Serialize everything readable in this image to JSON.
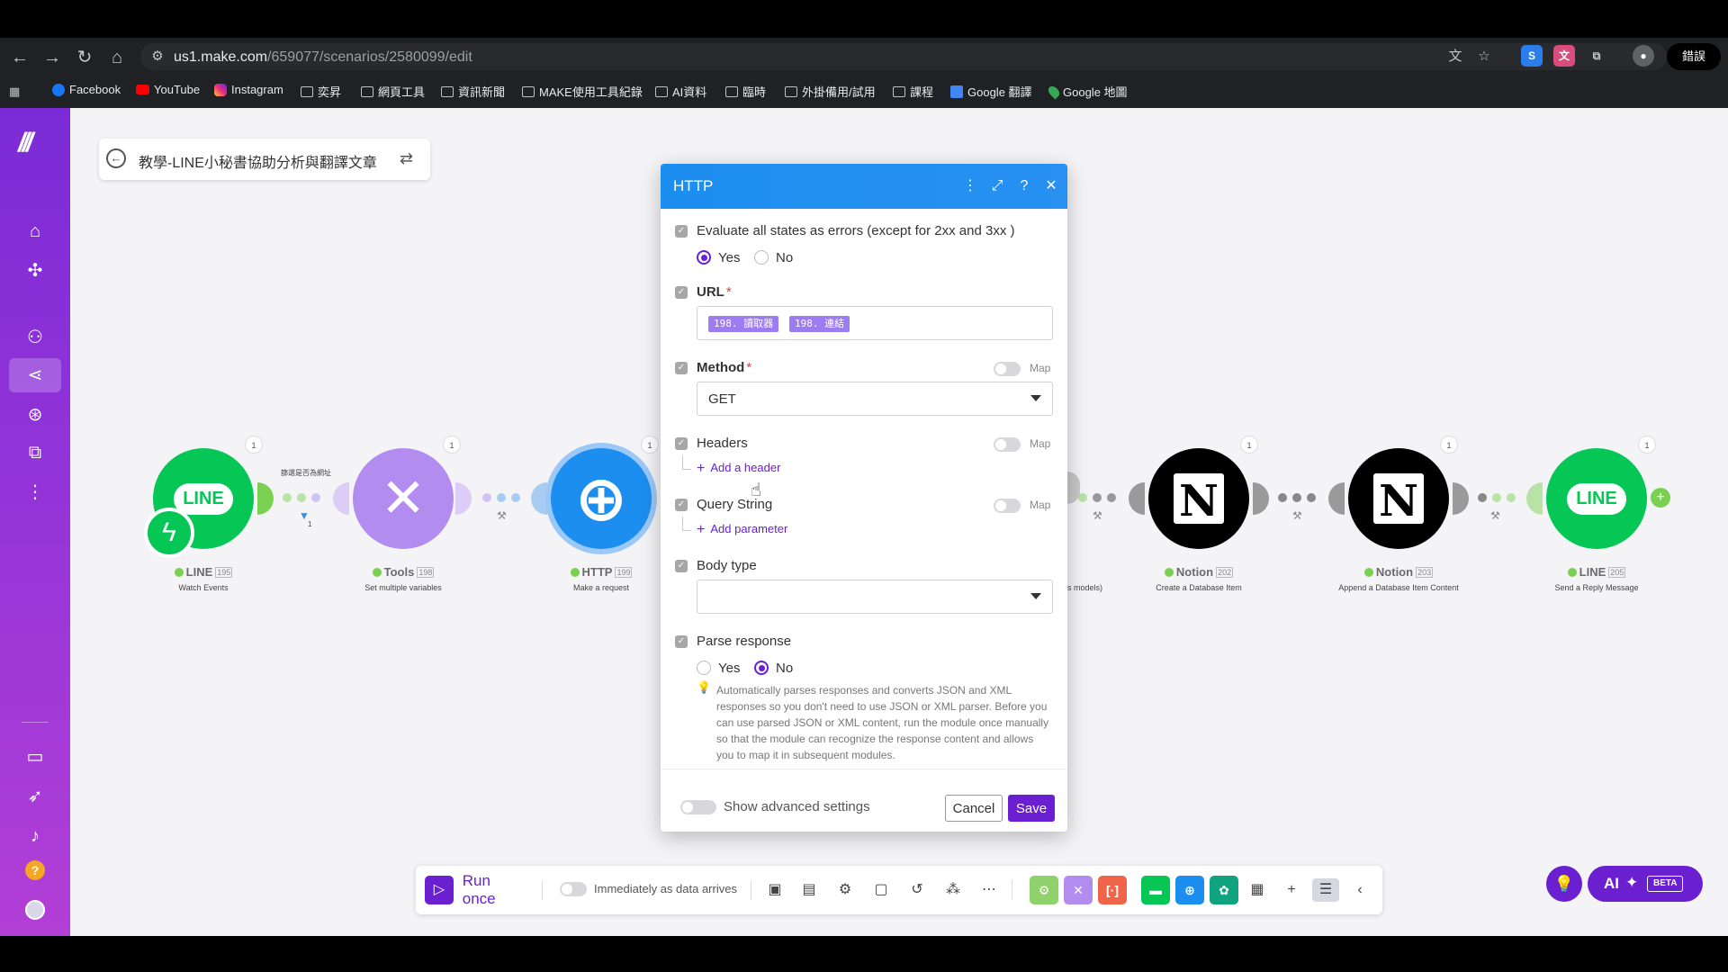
{
  "browser": {
    "url_host": "us1.make.com",
    "url_path": "/659077/scenarios/2580099/edit",
    "error_button": "錯誤",
    "bookmarks": [
      "Facebook",
      "YouTube",
      "Instagram",
      "奕昇",
      "網頁工具",
      "資訊新聞",
      "MAKE使用工具紀錄",
      "AI資料",
      "臨時",
      "外掛備用/試用",
      "課程",
      "Google 翻譯",
      "Google 地圖"
    ]
  },
  "scenario": {
    "title": "教學-LINE小秘書協助分析與翻譯文章"
  },
  "modules": [
    {
      "app": "LINE",
      "num": "195",
      "subtitle": "Watch Events",
      "badge": "1",
      "color": "#06c755"
    },
    {
      "app": "Tools",
      "num": "198",
      "subtitle": "Set multiple variables",
      "badge": "1",
      "color": "#b38cf0"
    },
    {
      "app": "HTTP",
      "num": "199",
      "subtitle": "Make a request",
      "badge": "1",
      "color": "#1c8ef0"
    },
    {
      "app": "Notion",
      "num": "202",
      "subtitle": "Create a Database Item",
      "badge": "1",
      "color": "#000000"
    },
    {
      "app": "Notion",
      "num": "203",
      "subtitle": "Append a Database Item Content",
      "badge": "1",
      "color": "#000000"
    },
    {
      "app": "LINE",
      "num": "205",
      "subtitle": "Send a Reply Message",
      "badge": "1",
      "color": "#06c755"
    }
  ],
  "filter_label": "篩選是否為網址",
  "filter_count": "1",
  "partial_label": "s models)",
  "dialog": {
    "title": "HTTP",
    "evaluate_label": "Evaluate all states as errors (except for 2xx and 3xx )",
    "evaluate_yes": "Yes",
    "evaluate_no": "No",
    "url_label": "URL",
    "url_required": "*",
    "url_pill_1": "198. 讀取器",
    "url_pill_2": "198. 連結",
    "method_label": "Method",
    "method_required": "*",
    "method_value": "GET",
    "map_label": "Map",
    "headers_label": "Headers",
    "add_header": "Add a header",
    "query_label": "Query String",
    "add_parameter": "Add parameter",
    "body_type_label": "Body type",
    "body_type_value": "",
    "parse_label": "Parse response",
    "parse_yes": "Yes",
    "parse_no": "No",
    "parse_hint": "Automatically parses responses and converts JSON and XML responses so you don't need to use JSON or XML parser. Before you can use parsed JSON or XML content, run the module once manually so that the module can recognize the response content and allows you to map it in subsequent modules.",
    "advanced_label": "Show advanced settings",
    "cancel": "Cancel",
    "save": "Save"
  },
  "toolbar": {
    "run_once": "Run once",
    "schedule_label": "Immediately as data arrives",
    "ai_label": "AI",
    "beta": "BETA"
  }
}
